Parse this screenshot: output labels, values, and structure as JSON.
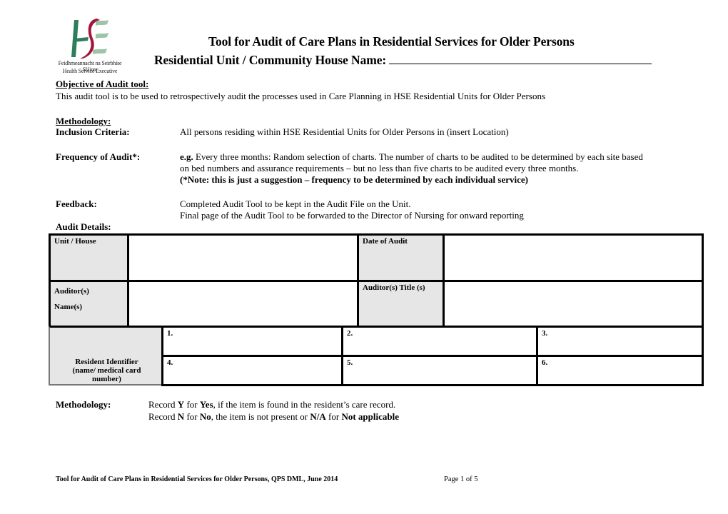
{
  "logo": {
    "icon": "hse-logo-icon",
    "line1": "Feidhmeannacht na Seirbhíse Sláinte",
    "line2": "Health Service Executive",
    "colors": {
      "green": "#2e7d5b",
      "red": "#a3163a",
      "light_green": "#9cc5a8"
    }
  },
  "header": {
    "title": "Tool for Audit of Care Plans in Residential Services for Older Persons",
    "subtitle": "Residential Unit / Community House Name:"
  },
  "objective": {
    "heading": "Objective of Audit tool:",
    "text": "This audit tool is to be used to retrospectively audit the processes used in Care Planning in HSE Residential Units for Older Persons"
  },
  "methodology": {
    "heading": "Methodology:",
    "inclusion_label": "Inclusion Criteria:",
    "inclusion_text": "All persons residing within HSE Residential Units for Older Persons in (insert Location)",
    "frequency_label": "Frequency of Audit*:",
    "frequency_eg": "e.g.",
    "frequency_line1": " Every three months: Random selection of charts. The number of charts to be audited to be determined by each site based",
    "frequency_line2": "on bed numbers and assurance requirements – but no less than five charts to be audited every three months.",
    "frequency_note": "(*Note: this is just a suggestion – frequency to be determined by each individual service)",
    "feedback_label": "Feedback:",
    "feedback_line1": "Completed Audit Tool to be kept in the Audit File on the Unit.",
    "feedback_line2": "Final page of the Audit Tool to be forwarded to the Director of Nursing for onward reporting"
  },
  "audit_details": {
    "heading": "Audit Details:",
    "unit_house_label": "Unit / House",
    "unit_house_value": "",
    "date_label": "Date of Audit",
    "date_value": "",
    "auditor_label_line1": "Auditor(s)",
    "auditor_label_line2": "Name(s)",
    "auditor_value": "",
    "auditor_title_label": "Auditor(s) Title (s)",
    "auditor_title_value": "",
    "resident_identifier_label": "Resident Identifier (name/ medical card number)",
    "residents": [
      "1.",
      "2.",
      "3.",
      "4.",
      "5.",
      "6."
    ]
  },
  "record_method": {
    "label": "Methodology:",
    "line1_a": "Record ",
    "line1_b": "Y",
    "line1_c": " for ",
    "line1_d": "Yes",
    "line1_e": ", if the item is found in the resident’s care record.",
    "line2_a": "Record ",
    "line2_b": "N",
    "line2_c": " for ",
    "line2_d": "No",
    "line2_e": ", the item is not present or ",
    "line2_f": "N/A",
    "line2_g": " for ",
    "line2_h": "Not applicable"
  },
  "footer": {
    "text": "Tool for Audit of Care Plans in Residential Services for Older Persons, QPS DML, June 2014",
    "page": "Page 1 of 5"
  }
}
